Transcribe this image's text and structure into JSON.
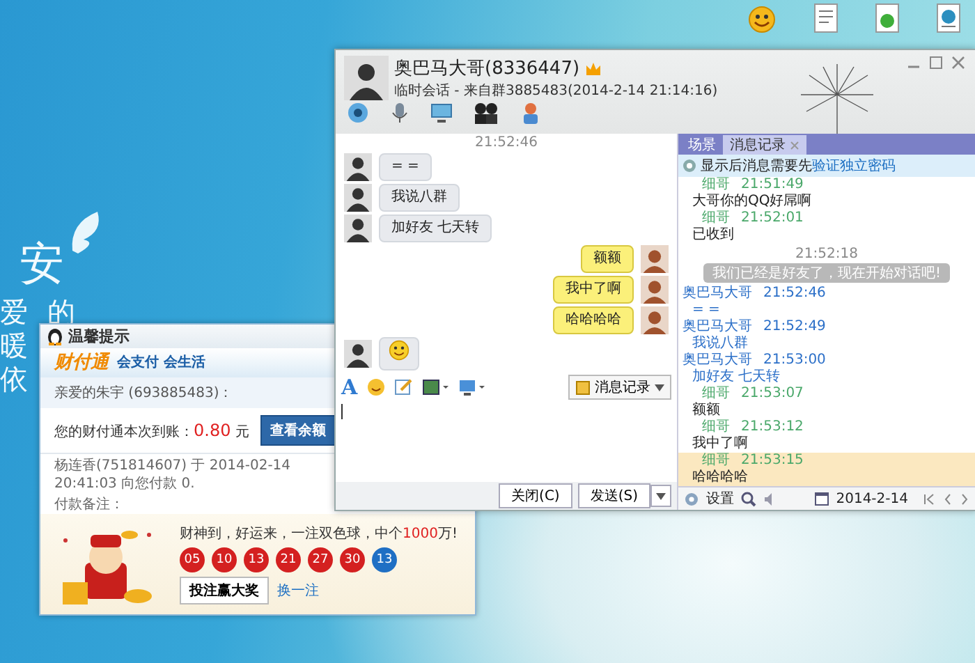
{
  "desktop": {
    "logo": "安",
    "wallpaper_lines": [
      "爱的",
      "暖",
      "依"
    ],
    "icons": [
      {
        "kind": "ftp"
      },
      {
        "kind": "document"
      },
      {
        "kind": "green-document"
      },
      {
        "kind": "globe-document"
      }
    ]
  },
  "notice": {
    "title": "温馨提示",
    "brand": "财付通",
    "slogan": "会支付 会生活",
    "greeting": "亲爱的朱宇 (693885483)：",
    "amount_label": "您的财付通本次到账：",
    "amount": "0.80",
    "unit": "元",
    "balance_button": "查看余额",
    "detail": "杨连香(751814607) 于 2014-02-14 20:41:03 向您付款 0.",
    "remark": "付款备注：",
    "lottery": {
      "before": "财神到，好运来，一注双色球，中个",
      "highlight": "1000",
      "after": "万!"
    },
    "balls": [
      {
        "number": "05",
        "color": "#d42020"
      },
      {
        "number": "10",
        "color": "#d42020"
      },
      {
        "number": "13",
        "color": "#d42020"
      },
      {
        "number": "21",
        "color": "#d42020"
      },
      {
        "number": "27",
        "color": "#d42020"
      },
      {
        "number": "30",
        "color": "#d42020"
      },
      {
        "number": "13",
        "color": "#1f6fc4"
      }
    ],
    "bet_button": "投注赢大奖",
    "change_link": "换一注"
  },
  "chat": {
    "title": "奥巴马大哥(8336447)",
    "subtitle": "临时会话 - 来自群3885483(2014-2-14 21:14:16)",
    "timestamp": "21:52:46",
    "messages": [
      {
        "outgoing": false,
        "kind": "text",
        "text": "= ="
      },
      {
        "outgoing": false,
        "kind": "text",
        "text": "我说八群"
      },
      {
        "outgoing": false,
        "kind": "text",
        "text": "加好友 七天转"
      },
      {
        "outgoing": true,
        "kind": "text",
        "text": "额额"
      },
      {
        "outgoing": true,
        "kind": "text",
        "text": "我中了啊"
      },
      {
        "outgoing": true,
        "kind": "text",
        "text": "哈哈哈哈"
      },
      {
        "outgoing": false,
        "kind": "emoticon"
      }
    ],
    "font_glyph": "A",
    "history_button": "消息记录",
    "close_button": "关闭(C)",
    "send_button": "发送(S)"
  },
  "history": {
    "tabs": [
      {
        "label": "场景",
        "selected": false
      },
      {
        "label": "消息记录",
        "selected": true
      }
    ],
    "notice_text": "显示后消息需要先",
    "notice_link": "验证独立密码",
    "entries": [
      {
        "kind": "message",
        "self": true,
        "sender": "细哥",
        "time": "21:51:49",
        "text": "大哥你的QQ好屌啊",
        "highlighted": false
      },
      {
        "kind": "message",
        "self": true,
        "sender": "细哥",
        "time": "21:52:01",
        "text": "已收到",
        "highlighted": false
      },
      {
        "kind": "system",
        "time": "21:52:18",
        "text": "我们已经是好友了，现在开始对话吧!"
      },
      {
        "kind": "message",
        "self": false,
        "sender": "奥巴马大哥",
        "time": "21:52:46",
        "text": "= =",
        "highlighted": false
      },
      {
        "kind": "message",
        "self": false,
        "sender": "奥巴马大哥",
        "time": "21:52:49",
        "text": "我说八群",
        "highlighted": false
      },
      {
        "kind": "message",
        "self": false,
        "sender": "奥巴马大哥",
        "time": "21:53:00",
        "text": "加好友 七天转",
        "highlighted": false
      },
      {
        "kind": "message",
        "self": true,
        "sender": "细哥",
        "time": "21:53:07",
        "text": "额额",
        "highlighted": false
      },
      {
        "kind": "message",
        "self": true,
        "sender": "细哥",
        "time": "21:53:12",
        "text": "我中了啊",
        "highlighted": false
      },
      {
        "kind": "message",
        "self": true,
        "sender": "细哥",
        "time": "21:53:15",
        "text": "哈哈哈哈",
        "highlighted": true
      }
    ],
    "settings": "设置",
    "date": "2014-2-14"
  }
}
